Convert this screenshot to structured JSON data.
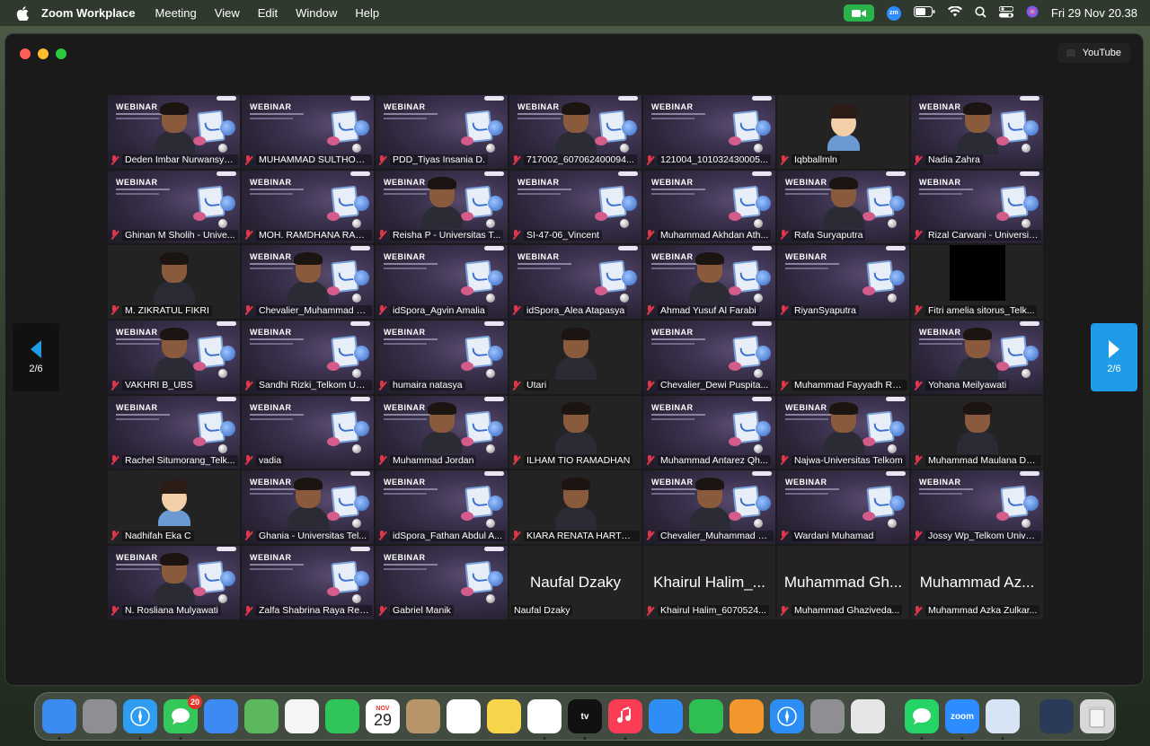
{
  "menubar": {
    "app_name": "Zoom Workplace",
    "menus": [
      "Meeting",
      "View",
      "Edit",
      "Window",
      "Help"
    ],
    "datetime": "Fri 29 Nov  20.38"
  },
  "window": {
    "share_label": "YouTube",
    "page_indicator_left": "2/6",
    "page_indicator_right": "2/6"
  },
  "participants": [
    {
      "name": "Deden Imbar Nurwansya...",
      "kind": "slide",
      "muted": true
    },
    {
      "name": "MUHAMMAD SULTHON...",
      "kind": "slide",
      "muted": true
    },
    {
      "name": "PDD_Tiyas Insania D.",
      "kind": "slide",
      "muted": true
    },
    {
      "name": "717002_607062400094...",
      "kind": "slide",
      "muted": true
    },
    {
      "name": "121004_101032430005...",
      "kind": "slide",
      "muted": true
    },
    {
      "name": "Iqbballmln",
      "kind": "avatar",
      "muted": true
    },
    {
      "name": "Nadia Zahra",
      "kind": "slide",
      "muted": true
    },
    {
      "name": "Ghinan M Sholih - Unive...",
      "kind": "slide",
      "muted": true
    },
    {
      "name": "MOH. RAMDHANA RAFI...",
      "kind": "slide",
      "muted": true
    },
    {
      "name": "Reisha P - Universitas T...",
      "kind": "slide",
      "muted": true
    },
    {
      "name": "SI-47-06_Vincent",
      "kind": "slide",
      "muted": true
    },
    {
      "name": "Muhammad Akhdan Ath...",
      "kind": "slide",
      "muted": true
    },
    {
      "name": "Rafa Suryaputra",
      "kind": "slide",
      "muted": true
    },
    {
      "name": "Rizal Carwani - Universit...",
      "kind": "slide",
      "muted": true
    },
    {
      "name": "M. ZIKRATUL FIKRI",
      "kind": "camera",
      "muted": true
    },
    {
      "name": "Chevalier_Muhammad R...",
      "kind": "slide",
      "muted": true
    },
    {
      "name": "idSpora_Agvin Amalia",
      "kind": "slide",
      "muted": true
    },
    {
      "name": "idSpora_Alea Atapasya",
      "kind": "slide",
      "muted": true
    },
    {
      "name": "Ahmad Yusuf Al Farabi",
      "kind": "slide",
      "muted": true
    },
    {
      "name": "RiyanSyaputra",
      "kind": "slide",
      "muted": true
    },
    {
      "name": "Fitri amelia sitorus_Telk...",
      "kind": "black",
      "muted": true
    },
    {
      "name": "VAKHRI B_UBS",
      "kind": "slide",
      "muted": true
    },
    {
      "name": "Sandhi Rizki_Telkom Uni...",
      "kind": "slide",
      "muted": true
    },
    {
      "name": "humaira natasya",
      "kind": "slide",
      "muted": true
    },
    {
      "name": "Utari",
      "kind": "camera",
      "muted": true
    },
    {
      "name": "Chevalier_Dewi Puspita...",
      "kind": "slide",
      "muted": true
    },
    {
      "name": "Muhammad Fayyadh Rai...",
      "kind": "dark",
      "muted": true
    },
    {
      "name": "Yohana Meilyawati",
      "kind": "slide",
      "muted": true
    },
    {
      "name": "Rachel Situmorang_Telk...",
      "kind": "slide",
      "muted": true
    },
    {
      "name": "vadia",
      "kind": "slide",
      "muted": true
    },
    {
      "name": "Muhammad Jordan",
      "kind": "slide",
      "muted": true
    },
    {
      "name": "ILHAM TIO RAMADHAN",
      "kind": "camera",
      "muted": true
    },
    {
      "name": "Muhammad Antarez Qh...",
      "kind": "slide",
      "muted": true
    },
    {
      "name": "Najwa-Universitas Telkom",
      "kind": "slide",
      "muted": true
    },
    {
      "name": "Muhammad Maulana Da...",
      "kind": "camera",
      "muted": true
    },
    {
      "name": "Nadhifah Eka C",
      "kind": "avatar",
      "muted": true
    },
    {
      "name": "Ghania - Universitas Tel...",
      "kind": "slide",
      "muted": true
    },
    {
      "name": "idSpora_Fathan Abdul A...",
      "kind": "slide",
      "muted": true
    },
    {
      "name": "KIARA RENATA HARTON...",
      "kind": "camera",
      "muted": true
    },
    {
      "name": "Chevalier_Muhammad H...",
      "kind": "slide",
      "muted": true
    },
    {
      "name": "Wardani Muhamad",
      "kind": "slide",
      "muted": true
    },
    {
      "name": "Jossy Wp_Telkom Unive...",
      "kind": "slide",
      "muted": true
    },
    {
      "name": "N. Rosliana Mulyawati",
      "kind": "slide",
      "muted": true
    },
    {
      "name": "Zalfa Shabrina Raya Rez...",
      "kind": "slide",
      "muted": true
    },
    {
      "name": "Gabriel Manik",
      "kind": "slide",
      "muted": true
    },
    {
      "name": "Naufal Dzaky",
      "kind": "name-only",
      "big": "Naufal Dzaky",
      "muted": false
    },
    {
      "name": "Khairul Halim_6070524...",
      "kind": "name-only",
      "big": "Khairul Halim_...",
      "muted": true
    },
    {
      "name": "Muhammad Ghaziveda...",
      "kind": "name-only",
      "big": "Muhammad Gh...",
      "muted": true
    },
    {
      "name": "Muhammad Azka Zulkar...",
      "kind": "name-only",
      "big": "Muhammad Az...",
      "muted": true
    }
  ],
  "slide_text": "WEBINAR",
  "dock": {
    "items": [
      {
        "name": "finder",
        "color": "#3b8cf0"
      },
      {
        "name": "launchpad",
        "color": "#8e8e93"
      },
      {
        "name": "safari",
        "color": "#2f9cf3"
      },
      {
        "name": "messages",
        "color": "#34c759",
        "badge": "20"
      },
      {
        "name": "mail",
        "color": "#3d8bf2"
      },
      {
        "name": "maps",
        "color": "#5cb85c"
      },
      {
        "name": "photos",
        "color": "#f5f5f5"
      },
      {
        "name": "facetime",
        "color": "#2fc55a"
      },
      {
        "name": "calendar",
        "color": "#ffffff",
        "month": "NOV",
        "day": "29"
      },
      {
        "name": "contacts",
        "color": "#b8946a"
      },
      {
        "name": "reminders",
        "color": "#ffffff"
      },
      {
        "name": "notes",
        "color": "#f7d54a"
      },
      {
        "name": "freeform",
        "color": "#ffffff"
      },
      {
        "name": "tv",
        "color": "#111111",
        "text": "tv"
      },
      {
        "name": "music",
        "color": "#fb3c55"
      },
      {
        "name": "keynote",
        "color": "#2f8ef5"
      },
      {
        "name": "numbers",
        "color": "#2ebe52"
      },
      {
        "name": "pages",
        "color": "#f3962c"
      },
      {
        "name": "app-store",
        "color": "#2c8ef4"
      },
      {
        "name": "system-settings",
        "color": "#8e8e93"
      },
      {
        "name": "iphone-mirroring",
        "color": "#e6e6e6"
      },
      {
        "name": "whatsapp",
        "color": "#25d366"
      },
      {
        "name": "zoom",
        "color": "#2d8cff",
        "text": "zoom"
      },
      {
        "name": "preview",
        "color": "#d6e4f5"
      },
      {
        "name": "downloads",
        "color": "#2a3b5a"
      },
      {
        "name": "trash",
        "color": "#d8d8d8"
      }
    ]
  }
}
